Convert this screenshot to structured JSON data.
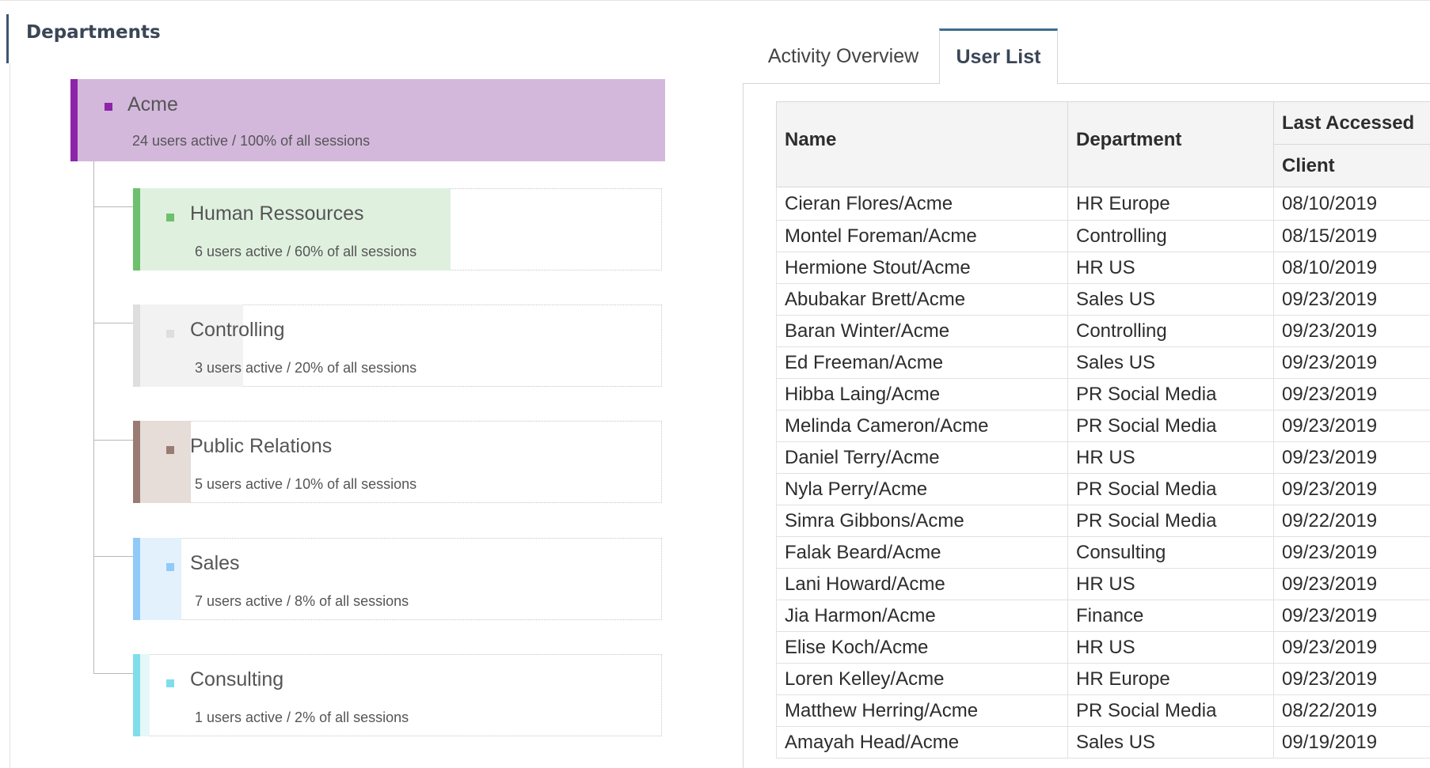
{
  "departments": {
    "title": "Departments",
    "nodes": [
      {
        "name": "Acme",
        "stats": "24 users active / 100% of all sessions",
        "color": "#8e24aa",
        "fill": "#d3b8dc"
      },
      {
        "name": "Human Ressources",
        "stats": "6 users active / 60% of all sessions",
        "color": "#6cc06e",
        "fill": "#dff0df",
        "share": 0.6
      },
      {
        "name": "Controlling",
        "stats": "3 users active / 20% of all sessions",
        "color": "#dedede",
        "fill": "#f2f2f2",
        "share": 0.2
      },
      {
        "name": "Public Relations",
        "stats": "5 users active / 10% of all sessions",
        "color": "#9a7b73",
        "fill": "#e6dcd8",
        "share": 0.1
      },
      {
        "name": "Sales",
        "stats": "7 users active / 8% of all sessions",
        "color": "#90caf9",
        "fill": "#e3f1fc",
        "share": 0.08
      },
      {
        "name": "Consulting",
        "stats": "1 users active / 2% of all sessions",
        "color": "#80deea",
        "fill": "#e5f7f9",
        "share": 0.02
      }
    ]
  },
  "tabs": [
    {
      "label": "Activity Overview",
      "active": false
    },
    {
      "label": "User List",
      "active": true
    }
  ],
  "user_table": {
    "group_header": "Last Accessed",
    "columns": [
      "Name",
      "Department",
      "Client"
    ],
    "rows": [
      [
        "Cieran Flores/Acme",
        "HR Europe",
        "08/10/2019"
      ],
      [
        "Montel Foreman/Acme",
        "Controlling",
        "08/15/2019"
      ],
      [
        "Hermione Stout/Acme",
        "HR US",
        "08/10/2019"
      ],
      [
        "Abubakar Brett/Acme",
        "Sales US",
        "09/23/2019"
      ],
      [
        "Baran Winter/Acme",
        "Controlling",
        "09/23/2019"
      ],
      [
        "Ed Freeman/Acme",
        "Sales US",
        "09/23/2019"
      ],
      [
        "Hibba Laing/Acme",
        "PR Social Media",
        "09/23/2019"
      ],
      [
        "Melinda Cameron/Acme",
        "PR Social Media",
        "09/23/2019"
      ],
      [
        "Daniel Terry/Acme",
        "HR US",
        "09/23/2019"
      ],
      [
        "Nyla Perry/Acme",
        "PR Social Media",
        "09/23/2019"
      ],
      [
        "Simra Gibbons/Acme",
        "PR Social Media",
        "09/22/2019"
      ],
      [
        "Falak Beard/Acme",
        "Consulting",
        "09/23/2019"
      ],
      [
        "Lani Howard/Acme",
        "HR US",
        "09/23/2019"
      ],
      [
        "Jia Harmon/Acme",
        "Finance",
        "09/23/2019"
      ],
      [
        "Elise Koch/Acme",
        "HR US",
        "09/23/2019"
      ],
      [
        "Loren Kelley/Acme",
        "HR Europe",
        "09/23/2019"
      ],
      [
        "Matthew Herring/Acme",
        "PR Social Media",
        "08/22/2019"
      ],
      [
        "Amayah Head/Acme",
        "Sales US",
        "09/19/2019"
      ]
    ]
  }
}
